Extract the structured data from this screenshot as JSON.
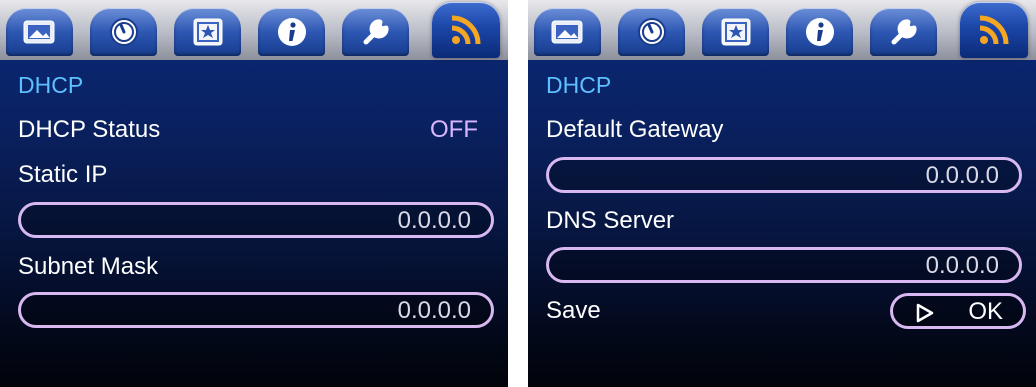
{
  "tabs": [
    {
      "name": "photo-icon"
    },
    {
      "name": "clock-icon"
    },
    {
      "name": "star-icon"
    },
    {
      "name": "info-icon"
    },
    {
      "name": "wrench-icon"
    },
    {
      "name": "rss-icon",
      "active": true
    }
  ],
  "left": {
    "section_title": "DHCP",
    "dhcp_status_label": "DHCP Status",
    "dhcp_status_value": "OFF",
    "static_ip_label": "Static IP",
    "static_ip_value": "0.0.0.0",
    "subnet_mask_label": "Subnet Mask",
    "subnet_mask_value": "0.0.0.0"
  },
  "right": {
    "section_title": "DHCP",
    "gateway_label": "Default Gateway",
    "gateway_value": "0.0.0.0",
    "dns_label": "DNS Server",
    "dns_value": "0.0.0.0",
    "save_label": "Save",
    "ok_label": "OK"
  },
  "colors": {
    "accent": "#5fc0ff",
    "value_text": "#d9b6ff",
    "field_border": "#d8b8f0",
    "rss_orange": "#f5a623"
  }
}
